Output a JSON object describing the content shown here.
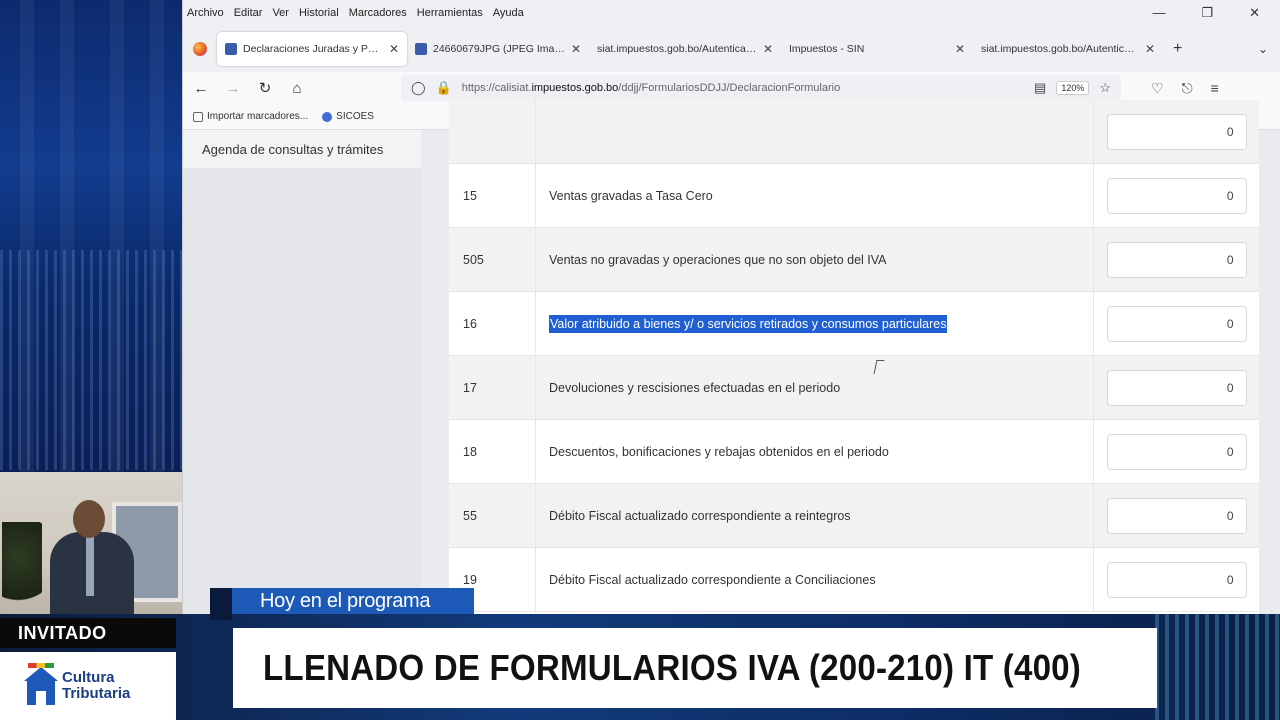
{
  "browser": {
    "menu": [
      "Archivo",
      "Editar",
      "Ver",
      "Historial",
      "Marcadores",
      "Herramientas",
      "Ayuda"
    ],
    "tabs": [
      {
        "label": "Declaraciones Juradas y Portal",
        "active": true
      },
      {
        "label": "24660679JPG (JPEG Imagen",
        "active": false
      },
      {
        "label": "siat.impuestos.gob.bo/Autenticacio",
        "active": false
      },
      {
        "label": "Impuestos - SIN",
        "active": false
      },
      {
        "label": "siat.impuestos.gob.bo/Autenticacio",
        "active": false
      }
    ],
    "url_prefix": "https://calisiat.",
    "url_domain": "impuestos.gob.bo",
    "url_path": "/ddjj/FormulariosDDJJ/DeclaracionFormulario",
    "zoom": "120%",
    "bookmarks": [
      "Importar marcadores...",
      "SICOES"
    ]
  },
  "sidebar": {
    "item": "Agenda de consultas y trámites"
  },
  "form": {
    "rows": [
      {
        "code": "",
        "desc": "",
        "value": "0"
      },
      {
        "code": "15",
        "desc": "Ventas gravadas a Tasa Cero",
        "value": "0"
      },
      {
        "code": "505",
        "desc": "Ventas no gravadas y operaciones que no son objeto del IVA",
        "value": "0"
      },
      {
        "code": "16",
        "desc": "Valor atribuido a bienes y/ o servicios retirados y consumos particulares",
        "value": "0"
      },
      {
        "code": "17",
        "desc": "Devoluciones y rescisiones efectuadas en el periodo",
        "value": "0"
      },
      {
        "code": "18",
        "desc": "Descuentos, bonificaciones y rebajas obtenidos en el periodo",
        "value": "0"
      },
      {
        "code": "55",
        "desc": "Débito Fiscal actualizado correspondiente a reintegros",
        "value": "0"
      },
      {
        "code": "19",
        "desc": "Débito Fiscal actualizado correspondiente a Conciliaciones",
        "value": "0"
      }
    ]
  },
  "broadcast": {
    "program_label": "Hoy en el programa",
    "guest_label": "INVITADO",
    "logo_line1": "Cultura",
    "logo_line2": "Tributaria",
    "title": "LLENADO DE FORMULARIOS IVA (200-210) IT (400)"
  },
  "colors": {
    "accent": "#1d5ab8",
    "highlight": "#1f5fd1"
  }
}
